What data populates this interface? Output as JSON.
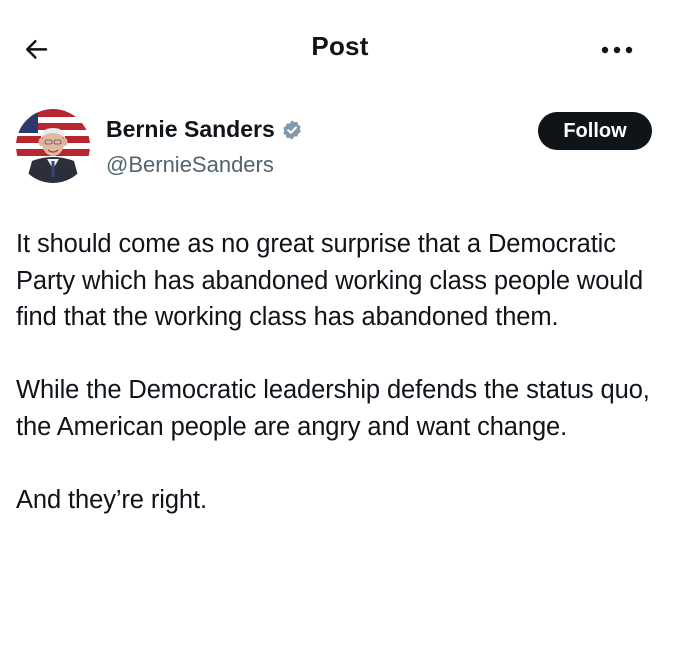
{
  "header": {
    "title": "Post",
    "back_icon": "arrow-left-icon",
    "more_icon": "more-horizontal-icon"
  },
  "author": {
    "name": "Bernie Sanders",
    "handle": "@BernieSanders",
    "verified_icon": "verified-badge-icon",
    "verified_color": "#829aab",
    "follow_label": "Follow"
  },
  "post": {
    "paragraphs": [
      "It should come as no great surprise that a Democratic Party which has abandoned working class people would find that the working class has abandoned them.",
      "While the Democratic leadership defends the status quo, the American people are angry and want change.",
      "And they’re right."
    ]
  },
  "colors": {
    "text": "#0f1419",
    "secondary": "#536471",
    "button_bg": "#0f1419",
    "background": "#ffffff"
  }
}
